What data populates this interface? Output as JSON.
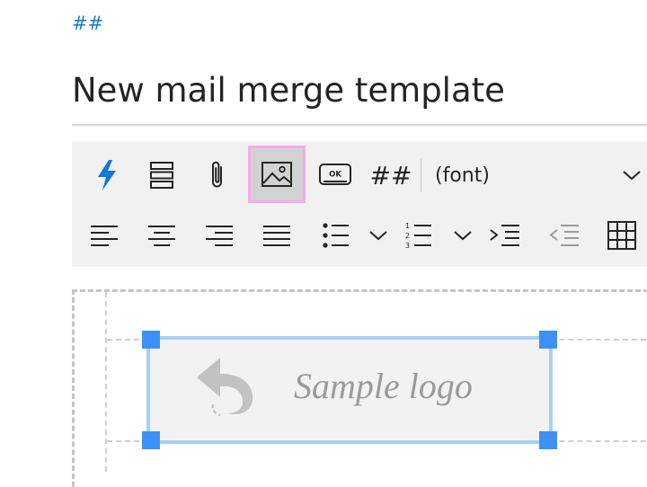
{
  "header": {
    "hash_link": "##",
    "title": "New mail merge template"
  },
  "toolbar": {
    "row1": [
      {
        "name": "insert-dynamic-content-button",
        "icon": "lightning-icon"
      },
      {
        "name": "insert-section-button",
        "icon": "stacked-rows-icon"
      },
      {
        "name": "attachment-button",
        "icon": "paperclip-icon"
      },
      {
        "name": "insert-image-button",
        "icon": "image-icon",
        "selected": true
      },
      {
        "name": "insert-button-button",
        "icon": "ok-button-icon"
      },
      {
        "name": "insert-placeholder-button",
        "text": "##"
      }
    ],
    "font_select": {
      "value": "(font)",
      "icon": "chevron-down-icon"
    },
    "row2": [
      {
        "name": "align-left-button",
        "icon": "align-left-icon"
      },
      {
        "name": "align-center-button",
        "icon": "align-center-icon"
      },
      {
        "name": "align-right-button",
        "icon": "align-right-icon"
      },
      {
        "name": "justify-button",
        "icon": "justify-icon"
      },
      {
        "name": "bulleted-list-button",
        "icon": "bulleted-list-icon"
      },
      {
        "name": "bulleted-list-dropdown",
        "icon": "chevron-down-icon"
      },
      {
        "name": "numbered-list-button",
        "icon": "numbered-list-icon"
      },
      {
        "name": "numbered-list-dropdown",
        "icon": "chevron-down-icon"
      },
      {
        "name": "increase-indent-button",
        "icon": "indent-icon"
      },
      {
        "name": "decrease-indent-button",
        "icon": "outdent-icon",
        "disabled": true
      },
      {
        "name": "insert-table-button",
        "icon": "table-icon"
      }
    ],
    "placeholder_text": "##"
  },
  "editor": {
    "logo_text": "Sample logo",
    "logo_icon": "undo-arrow-icon",
    "accent_color": "#3d91f5",
    "selection_border_color": "#a7cff3",
    "selected_tool_outline": "#f7a8ec"
  }
}
